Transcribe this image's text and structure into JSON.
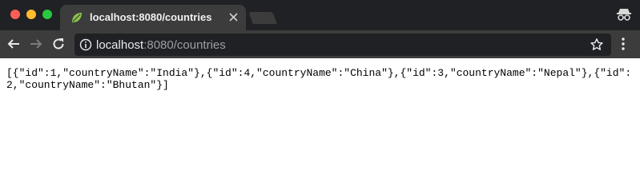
{
  "window": {
    "controls": [
      "close",
      "minimize",
      "zoom"
    ]
  },
  "tab": {
    "title": "localhost:8080/countries",
    "favicon": "spring-leaf-icon"
  },
  "toolbar": {
    "back_icon": "arrow-left-icon",
    "forward_icon": "arrow-right-icon",
    "reload_icon": "reload-icon",
    "url_host": "localhost",
    "url_rest": ":8080/countries"
  },
  "page": {
    "json_text": "[{\"id\":1,\"countryName\":\"India\"},{\"id\":4,\"countryName\":\"China\"},{\"id\":3,\"countryName\":\"Nepal\"},{\"id\":2,\"countryName\":\"Bhutan\"}]"
  },
  "colors": {
    "titlebar": "#202124",
    "active_tab": "#3c3c3c",
    "omnibox": "#202124",
    "accent_leaf": "#8bc34a"
  }
}
